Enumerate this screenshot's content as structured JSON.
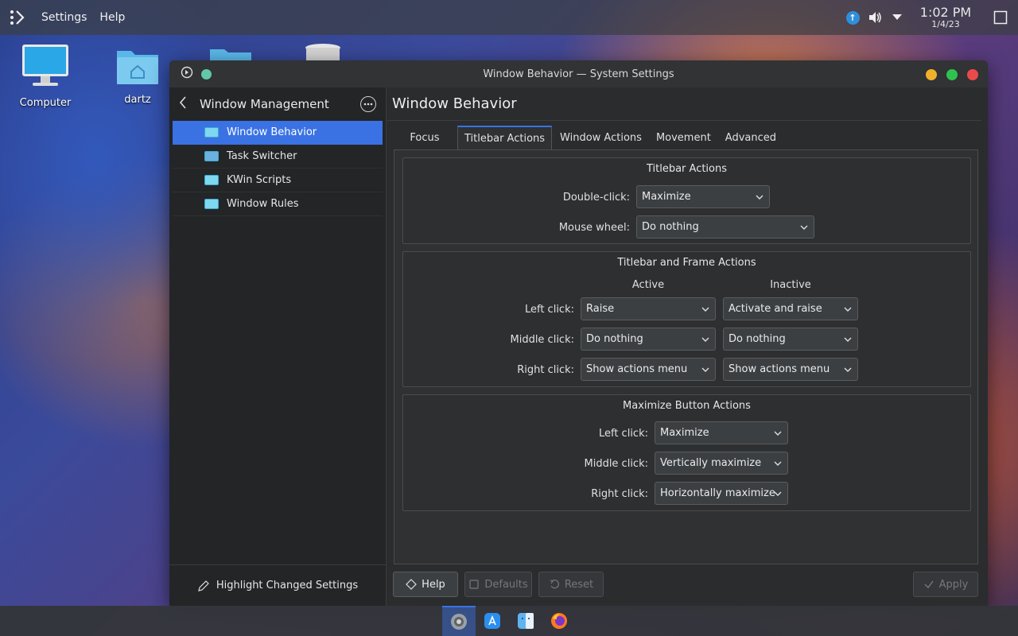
{
  "top_panel": {
    "menu": [
      "Settings",
      "Help"
    ],
    "clock_time": "1:02 PM",
    "clock_date": "1/4/23",
    "update_badge": "↑"
  },
  "desktop": {
    "icons": [
      {
        "label": "Computer",
        "icon": "computer-icon"
      },
      {
        "label": "dartz",
        "icon": "home-folder-icon"
      },
      {
        "label": "",
        "icon": "folder-icon"
      },
      {
        "label": "",
        "icon": "trash-icon"
      }
    ]
  },
  "window": {
    "title": "Window Behavior — System Settings",
    "buttons": {
      "minimize_color": "#f0b12a",
      "maximize_color": "#2fc24e",
      "close_color": "#ec4a4a"
    }
  },
  "sidebar": {
    "header": "Window Management",
    "items": [
      {
        "label": "Window Behavior",
        "active": true
      },
      {
        "label": "Task Switcher",
        "active": false
      },
      {
        "label": "KWin Scripts",
        "active": false
      },
      {
        "label": "Window Rules",
        "active": false
      }
    ],
    "footer": "Highlight Changed Settings"
  },
  "content": {
    "page_title": "Window Behavior",
    "tabs": [
      "Focus",
      "Titlebar Actions",
      "Window Actions",
      "Movement",
      "Advanced"
    ],
    "active_tab": "Titlebar Actions",
    "titlebar_actions": {
      "title": "Titlebar Actions",
      "double_click_label": "Double-click:",
      "double_click_value": "Maximize",
      "mouse_wheel_label": "Mouse wheel:",
      "mouse_wheel_value": "Do nothing"
    },
    "frame_actions": {
      "title": "Titlebar and Frame Actions",
      "col_active": "Active",
      "col_inactive": "Inactive",
      "left_label": "Left click:",
      "left_active": "Raise",
      "left_inactive": "Activate and raise",
      "middle_label": "Middle click:",
      "middle_active": "Do nothing",
      "middle_inactive": "Do nothing",
      "right_label": "Right click:",
      "right_active": "Show actions menu",
      "right_inactive": "Show actions menu"
    },
    "maximize_actions": {
      "title": "Maximize Button Actions",
      "left_label": "Left click:",
      "left_value": "Maximize",
      "middle_label": "Middle click:",
      "middle_value": "Vertically maximize",
      "right_label": "Right click:",
      "right_value": "Horizontally maximize"
    },
    "buttons": {
      "help": "Help",
      "defaults": "Defaults",
      "reset": "Reset",
      "apply": "Apply"
    }
  },
  "taskbar": {
    "items": [
      "system-settings-icon",
      "app-store-icon",
      "finder-icon",
      "firefox-icon"
    ],
    "accent": "#3a72e4"
  }
}
